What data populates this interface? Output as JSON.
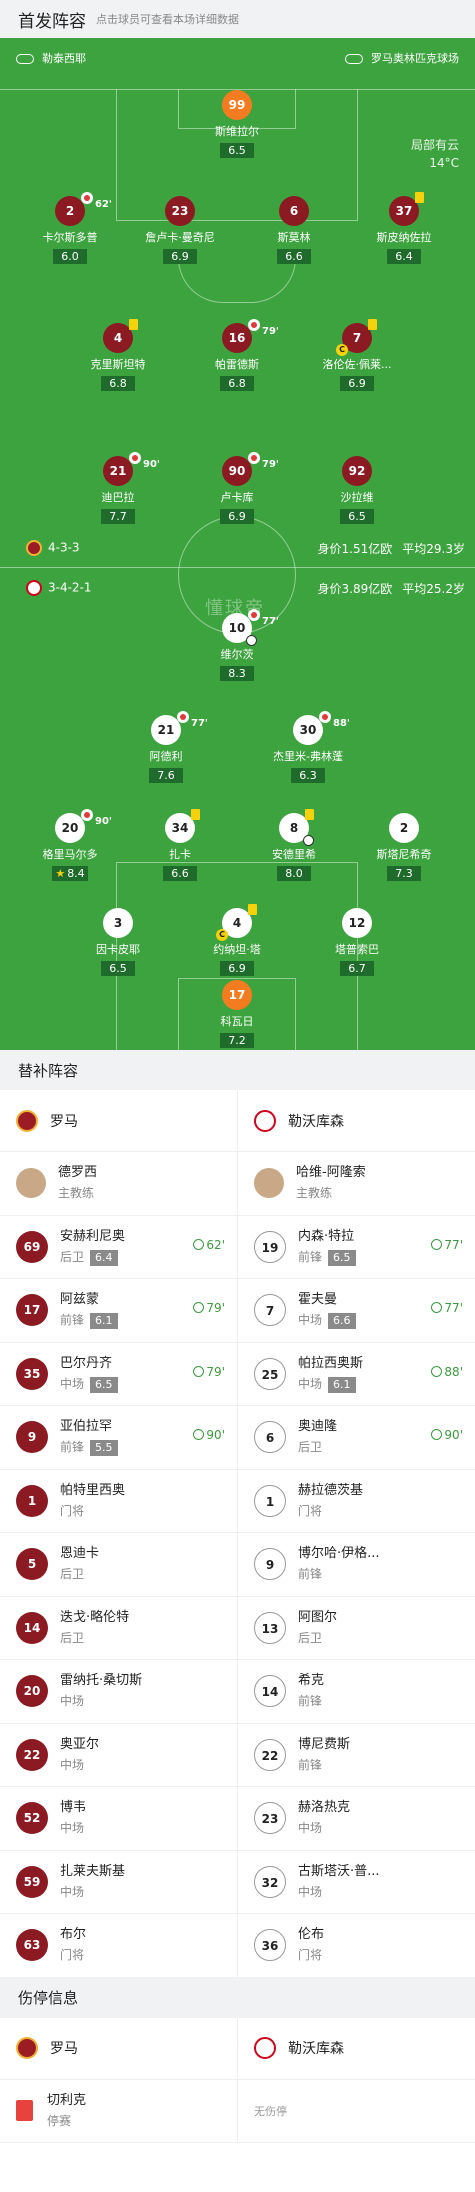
{
  "header": {
    "title": "首发阵容",
    "hint": "点击球员可查看本场详细数据"
  },
  "pitch": {
    "referee": "勒泰西耶",
    "stadium": "罗马奥林匹克球场",
    "weather": "局部有云",
    "temperature": "14°C",
    "watermark": "懂球帝",
    "home": {
      "formation": "4-3-3",
      "value": "身价1.51亿欧",
      "avg_age": "平均29.3岁"
    },
    "away": {
      "formation": "3-4-2-1",
      "value": "身价3.89亿欧",
      "avg_age": "平均25.2岁"
    }
  },
  "home_players": [
    {
      "num": "99",
      "name": "斯维拉尔",
      "rating": "6.5"
    },
    {
      "num": "2",
      "name": "卡尔斯多普",
      "rating": "6.0",
      "sub": "62'"
    },
    {
      "num": "23",
      "name": "詹卢卡·曼奇尼",
      "rating": "6.9"
    },
    {
      "num": "6",
      "name": "斯莫林",
      "rating": "6.6"
    },
    {
      "num": "37",
      "name": "斯皮纳佐拉",
      "rating": "6.4"
    },
    {
      "num": "4",
      "name": "克里斯坦特",
      "rating": "6.8"
    },
    {
      "num": "16",
      "name": "帕雷德斯",
      "rating": "6.8",
      "sub": "79'"
    },
    {
      "num": "7",
      "name": "洛伦佐·佩莱...",
      "rating": "6.9"
    },
    {
      "num": "21",
      "name": "迪巴拉",
      "rating": "7.7",
      "sub": "90'"
    },
    {
      "num": "90",
      "name": "卢卡库",
      "rating": "6.9",
      "sub": "79'"
    },
    {
      "num": "92",
      "name": "沙拉维",
      "rating": "6.5"
    }
  ],
  "away_players": [
    {
      "num": "10",
      "name": "维尔茨",
      "rating": "8.3",
      "sub": "77'"
    },
    {
      "num": "21",
      "name": "阿德利",
      "rating": "7.6",
      "sub": "77'"
    },
    {
      "num": "30",
      "name": "杰里米-弗林蓬",
      "rating": "6.3",
      "sub": "88'"
    },
    {
      "num": "20",
      "name": "格里马尔多",
      "rating": "8.4",
      "sub": "90'"
    },
    {
      "num": "34",
      "name": "扎卡",
      "rating": "6.6"
    },
    {
      "num": "8",
      "name": "安德里希",
      "rating": "8.0"
    },
    {
      "num": "2",
      "name": "斯塔尼希奇",
      "rating": "7.3"
    },
    {
      "num": "3",
      "name": "因卡皮耶",
      "rating": "6.5"
    },
    {
      "num": "4",
      "name": "约纳坦·塔",
      "rating": "6.9"
    },
    {
      "num": "12",
      "name": "塔普索巴",
      "rating": "6.7"
    },
    {
      "num": "17",
      "name": "科瓦日",
      "rating": "7.2"
    }
  ],
  "subs": {
    "title": "替补阵容",
    "home_team": "罗马",
    "away_team": "勒沃库森",
    "home_coach": {
      "name": "德罗西",
      "role": "主教练"
    },
    "away_coach": {
      "name": "哈维-阿隆索",
      "role": "主教练"
    },
    "home": [
      {
        "num": "69",
        "name": "安赫利尼奥",
        "pos": "后卫",
        "rating": "6.4",
        "min": "62'"
      },
      {
        "num": "17",
        "name": "阿兹蒙",
        "pos": "前锋",
        "rating": "6.1",
        "min": "79'"
      },
      {
        "num": "35",
        "name": "巴尔丹齐",
        "pos": "中场",
        "rating": "6.5",
        "min": "79'"
      },
      {
        "num": "9",
        "name": "亚伯拉罕",
        "pos": "前锋",
        "rating": "5.5",
        "min": "90'"
      },
      {
        "num": "1",
        "name": "帕特里西奥",
        "pos": "门将"
      },
      {
        "num": "5",
        "name": "恩迪卡",
        "pos": "后卫"
      },
      {
        "num": "14",
        "name": "迭戈·略伦特",
        "pos": "后卫"
      },
      {
        "num": "20",
        "name": "雷纳托·桑切斯",
        "pos": "中场"
      },
      {
        "num": "22",
        "name": "奥亚尔",
        "pos": "中场"
      },
      {
        "num": "52",
        "name": "博韦",
        "pos": "中场"
      },
      {
        "num": "59",
        "name": "扎莱夫斯基",
        "pos": "中场"
      },
      {
        "num": "63",
        "name": "布尔",
        "pos": "门将"
      }
    ],
    "away": [
      {
        "num": "19",
        "name": "内森·特拉",
        "pos": "前锋",
        "rating": "6.5",
        "min": "77'"
      },
      {
        "num": "7",
        "name": "霍夫曼",
        "pos": "中场",
        "rating": "6.6",
        "min": "77'"
      },
      {
        "num": "25",
        "name": "帕拉西奥斯",
        "pos": "中场",
        "rating": "6.1",
        "min": "88'"
      },
      {
        "num": "6",
        "name": "奥迪隆",
        "pos": "后卫",
        "min": "90'"
      },
      {
        "num": "1",
        "name": "赫拉德茨基",
        "pos": "门将"
      },
      {
        "num": "9",
        "name": "博尔哈·伊格...",
        "pos": "前锋"
      },
      {
        "num": "13",
        "name": "阿图尔",
        "pos": "后卫"
      },
      {
        "num": "14",
        "name": "希克",
        "pos": "前锋"
      },
      {
        "num": "22",
        "name": "博尼费斯",
        "pos": "前锋"
      },
      {
        "num": "23",
        "name": "赫洛热克",
        "pos": "中场"
      },
      {
        "num": "32",
        "name": "古斯塔沃·普...",
        "pos": "中场"
      },
      {
        "num": "36",
        "name": "伦布",
        "pos": "门将"
      }
    ]
  },
  "injuries": {
    "title": "伤停信息",
    "home_team": "罗马",
    "away_team": "勒沃库森",
    "home_player": {
      "name": "切利克",
      "status": "停赛"
    },
    "away_none": "无伤停"
  },
  "colors": {
    "pitch": "#3da33f",
    "roma": "#8c1a23",
    "sub_in": "#3b9a3e",
    "red_card": "#e8423f"
  }
}
